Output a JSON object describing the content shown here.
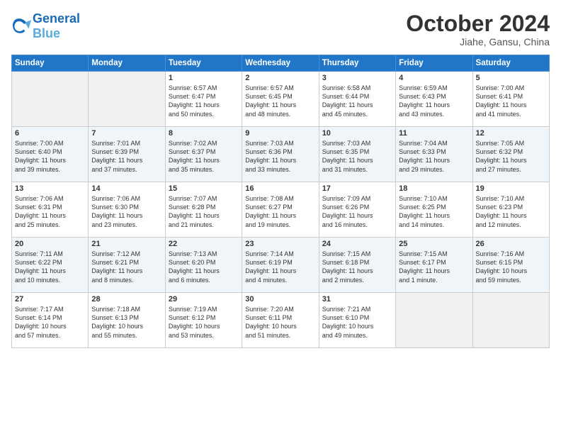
{
  "header": {
    "logo_general": "General",
    "logo_blue": "Blue",
    "month": "October 2024",
    "location": "Jiahe, Gansu, China"
  },
  "weekdays": [
    "Sunday",
    "Monday",
    "Tuesday",
    "Wednesday",
    "Thursday",
    "Friday",
    "Saturday"
  ],
  "weeks": [
    [
      {
        "day": "",
        "info": ""
      },
      {
        "day": "",
        "info": ""
      },
      {
        "day": "1",
        "info": "Sunrise: 6:57 AM\nSunset: 6:47 PM\nDaylight: 11 hours\nand 50 minutes."
      },
      {
        "day": "2",
        "info": "Sunrise: 6:57 AM\nSunset: 6:45 PM\nDaylight: 11 hours\nand 48 minutes."
      },
      {
        "day": "3",
        "info": "Sunrise: 6:58 AM\nSunset: 6:44 PM\nDaylight: 11 hours\nand 45 minutes."
      },
      {
        "day": "4",
        "info": "Sunrise: 6:59 AM\nSunset: 6:43 PM\nDaylight: 11 hours\nand 43 minutes."
      },
      {
        "day": "5",
        "info": "Sunrise: 7:00 AM\nSunset: 6:41 PM\nDaylight: 11 hours\nand 41 minutes."
      }
    ],
    [
      {
        "day": "6",
        "info": "Sunrise: 7:00 AM\nSunset: 6:40 PM\nDaylight: 11 hours\nand 39 minutes."
      },
      {
        "day": "7",
        "info": "Sunrise: 7:01 AM\nSunset: 6:39 PM\nDaylight: 11 hours\nand 37 minutes."
      },
      {
        "day": "8",
        "info": "Sunrise: 7:02 AM\nSunset: 6:37 PM\nDaylight: 11 hours\nand 35 minutes."
      },
      {
        "day": "9",
        "info": "Sunrise: 7:03 AM\nSunset: 6:36 PM\nDaylight: 11 hours\nand 33 minutes."
      },
      {
        "day": "10",
        "info": "Sunrise: 7:03 AM\nSunset: 6:35 PM\nDaylight: 11 hours\nand 31 minutes."
      },
      {
        "day": "11",
        "info": "Sunrise: 7:04 AM\nSunset: 6:33 PM\nDaylight: 11 hours\nand 29 minutes."
      },
      {
        "day": "12",
        "info": "Sunrise: 7:05 AM\nSunset: 6:32 PM\nDaylight: 11 hours\nand 27 minutes."
      }
    ],
    [
      {
        "day": "13",
        "info": "Sunrise: 7:06 AM\nSunset: 6:31 PM\nDaylight: 11 hours\nand 25 minutes."
      },
      {
        "day": "14",
        "info": "Sunrise: 7:06 AM\nSunset: 6:30 PM\nDaylight: 11 hours\nand 23 minutes."
      },
      {
        "day": "15",
        "info": "Sunrise: 7:07 AM\nSunset: 6:28 PM\nDaylight: 11 hours\nand 21 minutes."
      },
      {
        "day": "16",
        "info": "Sunrise: 7:08 AM\nSunset: 6:27 PM\nDaylight: 11 hours\nand 19 minutes."
      },
      {
        "day": "17",
        "info": "Sunrise: 7:09 AM\nSunset: 6:26 PM\nDaylight: 11 hours\nand 16 minutes."
      },
      {
        "day": "18",
        "info": "Sunrise: 7:10 AM\nSunset: 6:25 PM\nDaylight: 11 hours\nand 14 minutes."
      },
      {
        "day": "19",
        "info": "Sunrise: 7:10 AM\nSunset: 6:23 PM\nDaylight: 11 hours\nand 12 minutes."
      }
    ],
    [
      {
        "day": "20",
        "info": "Sunrise: 7:11 AM\nSunset: 6:22 PM\nDaylight: 11 hours\nand 10 minutes."
      },
      {
        "day": "21",
        "info": "Sunrise: 7:12 AM\nSunset: 6:21 PM\nDaylight: 11 hours\nand 8 minutes."
      },
      {
        "day": "22",
        "info": "Sunrise: 7:13 AM\nSunset: 6:20 PM\nDaylight: 11 hours\nand 6 minutes."
      },
      {
        "day": "23",
        "info": "Sunrise: 7:14 AM\nSunset: 6:19 PM\nDaylight: 11 hours\nand 4 minutes."
      },
      {
        "day": "24",
        "info": "Sunrise: 7:15 AM\nSunset: 6:18 PM\nDaylight: 11 hours\nand 2 minutes."
      },
      {
        "day": "25",
        "info": "Sunrise: 7:15 AM\nSunset: 6:17 PM\nDaylight: 11 hours\nand 1 minute."
      },
      {
        "day": "26",
        "info": "Sunrise: 7:16 AM\nSunset: 6:15 PM\nDaylight: 10 hours\nand 59 minutes."
      }
    ],
    [
      {
        "day": "27",
        "info": "Sunrise: 7:17 AM\nSunset: 6:14 PM\nDaylight: 10 hours\nand 57 minutes."
      },
      {
        "day": "28",
        "info": "Sunrise: 7:18 AM\nSunset: 6:13 PM\nDaylight: 10 hours\nand 55 minutes."
      },
      {
        "day": "29",
        "info": "Sunrise: 7:19 AM\nSunset: 6:12 PM\nDaylight: 10 hours\nand 53 minutes."
      },
      {
        "day": "30",
        "info": "Sunrise: 7:20 AM\nSunset: 6:11 PM\nDaylight: 10 hours\nand 51 minutes."
      },
      {
        "day": "31",
        "info": "Sunrise: 7:21 AM\nSunset: 6:10 PM\nDaylight: 10 hours\nand 49 minutes."
      },
      {
        "day": "",
        "info": ""
      },
      {
        "day": "",
        "info": ""
      }
    ]
  ]
}
